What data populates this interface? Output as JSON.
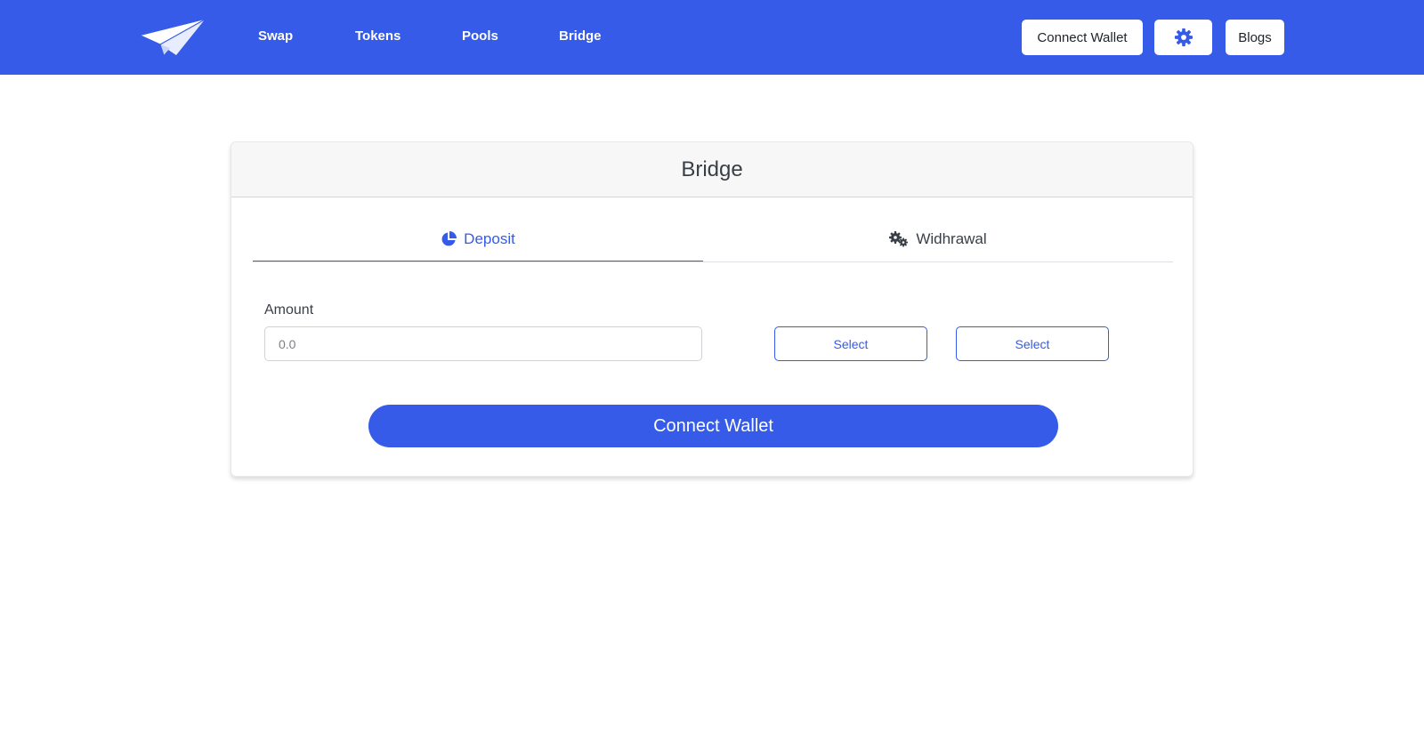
{
  "nav": {
    "logo_icon": "paper-plane-icon",
    "links": [
      "Swap",
      "Tokens",
      "Pools",
      "Bridge"
    ],
    "connect_wallet_label": "Connect Wallet",
    "settings_icon": "gear-icon",
    "blogs_label": "Blogs"
  },
  "card": {
    "title": "Bridge",
    "tabs": [
      {
        "label": "Deposit",
        "icon": "pie-chart-icon",
        "active": true
      },
      {
        "label": "Widhrawal",
        "icon": "cogs-icon",
        "active": false
      }
    ],
    "amount_label": "Amount",
    "amount_placeholder": "0.0",
    "select_labels": [
      "Select",
      "Select"
    ],
    "connect_wallet_label": "Connect Wallet"
  },
  "colors": {
    "brand": "#355be8",
    "header_bg": "#f7f7f7",
    "text": "#3a3f47"
  }
}
